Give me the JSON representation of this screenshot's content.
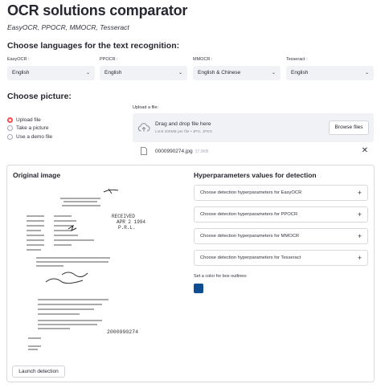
{
  "header": {
    "title": "OCR solutions comparator",
    "subtitle": "EasyOCR, PPOCR, MMOCR, Tesseract"
  },
  "languages": {
    "heading": "Choose languages for the text recognition:",
    "selects": [
      {
        "label": "EasyOCR :",
        "value": "English"
      },
      {
        "label": "PPOCR :",
        "value": "English"
      },
      {
        "label": "MMOCR :",
        "value": "English & Chinese"
      },
      {
        "label": "Tesseract :",
        "value": "English"
      }
    ]
  },
  "picture": {
    "heading": "Choose picture:",
    "options": [
      "Upload file",
      "Take a picture",
      "Use a demo file"
    ],
    "selected_option": "Upload file",
    "upload_label": "Upload a file:",
    "dropzone_main": "Drag and drop file here",
    "dropzone_sub": "Limit 200MB per file • JPG, JPEG",
    "browse_label": "Browse files",
    "file_name": "0000990274.jpg",
    "file_size": "17.0KB"
  },
  "results": {
    "original_heading": "Original image",
    "hyper_heading": "Hyperparameters values for detection",
    "expanders": [
      "Choose detection hyperparameters for EasyOCR",
      "Choose detection hyperparameters for PPOCR",
      "Choose detection hyperparameters for MMOCR",
      "Choose detection hyperparameters for Tesseract"
    ],
    "color_label": "Set a color for box outlines:",
    "box_color": "#0e4d92",
    "launch_label": "Launch detection"
  },
  "colors": {
    "accent": "#ff4b4b",
    "widget_bg": "#f0f2f6"
  }
}
